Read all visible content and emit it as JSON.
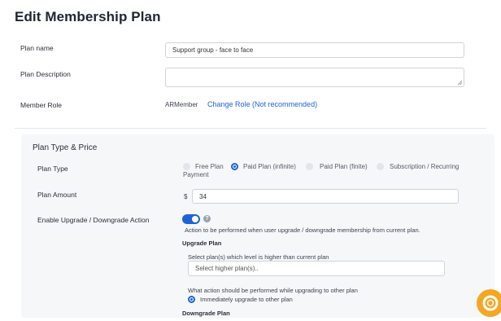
{
  "page": {
    "title": "Edit Membership Plan"
  },
  "plan_name": {
    "label": "Plan name",
    "value": "Support group - face to face"
  },
  "plan_description": {
    "label": "Plan Description",
    "value": ""
  },
  "member_role": {
    "label": "Member Role",
    "value": "ARMember",
    "change_link": "Change Role (Not recommended)"
  },
  "plan_type_price": {
    "section_title": "Plan Type & Price",
    "plan_type": {
      "label": "Plan Type",
      "options": [
        {
          "label": "Free Plan",
          "selected": false
        },
        {
          "label": "Paid Plan (infinite)",
          "selected": true
        },
        {
          "label": "Paid Plan (finite)",
          "selected": false
        },
        {
          "label": "Subscription / Recurring",
          "label2": "Payment",
          "selected": false
        }
      ]
    },
    "plan_amount": {
      "label": "Plan Amount",
      "currency": "$",
      "value": "34"
    },
    "upgrade_downgrade": {
      "label": "Enable Upgrade / Downgrade Action",
      "enabled": true,
      "help_icon": "question-circle-icon",
      "description": "Action to be performed when user upgrade / downgrade membership from current plan.",
      "upgrade_plan": {
        "heading": "Upgrade Plan",
        "select_label": "Select plan(s) which level is higher than current plan",
        "select_placeholder": "Select higher plan(s)..",
        "action_question": "What action should be performed while upgrading to other plan",
        "action_option": "Immediately upgrade to other plan"
      },
      "downgrade_plan": {
        "heading": "Downgrade Plan"
      }
    }
  },
  "colors": {
    "accent": "#1e63d6",
    "fab": "#f5a623"
  }
}
